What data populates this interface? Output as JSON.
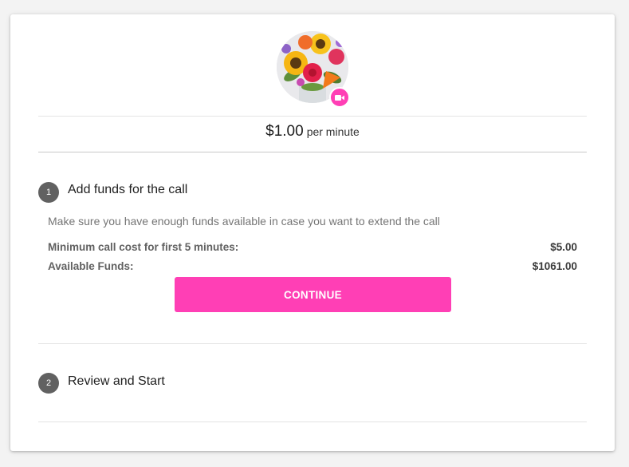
{
  "pricing": {
    "amount": "$1.00",
    "unit": "per minute"
  },
  "steps": [
    {
      "number": "1",
      "title": "Add funds for the call",
      "hint": "Make sure you have enough funds available in case you want to extend the call",
      "rows": [
        {
          "label": "Minimum call cost for first 5 minutes:",
          "value": "$5.00"
        },
        {
          "label": "Available Funds:",
          "value": "$1061.00"
        }
      ],
      "button_label": "CONTINUE"
    },
    {
      "number": "2",
      "title": "Review and Start"
    }
  ],
  "icons": {
    "badge": "video-camera-icon",
    "avatar": "flower-bouquet-avatar"
  },
  "colors": {
    "accent": "#ff3fb5",
    "step_circle": "#616161"
  }
}
